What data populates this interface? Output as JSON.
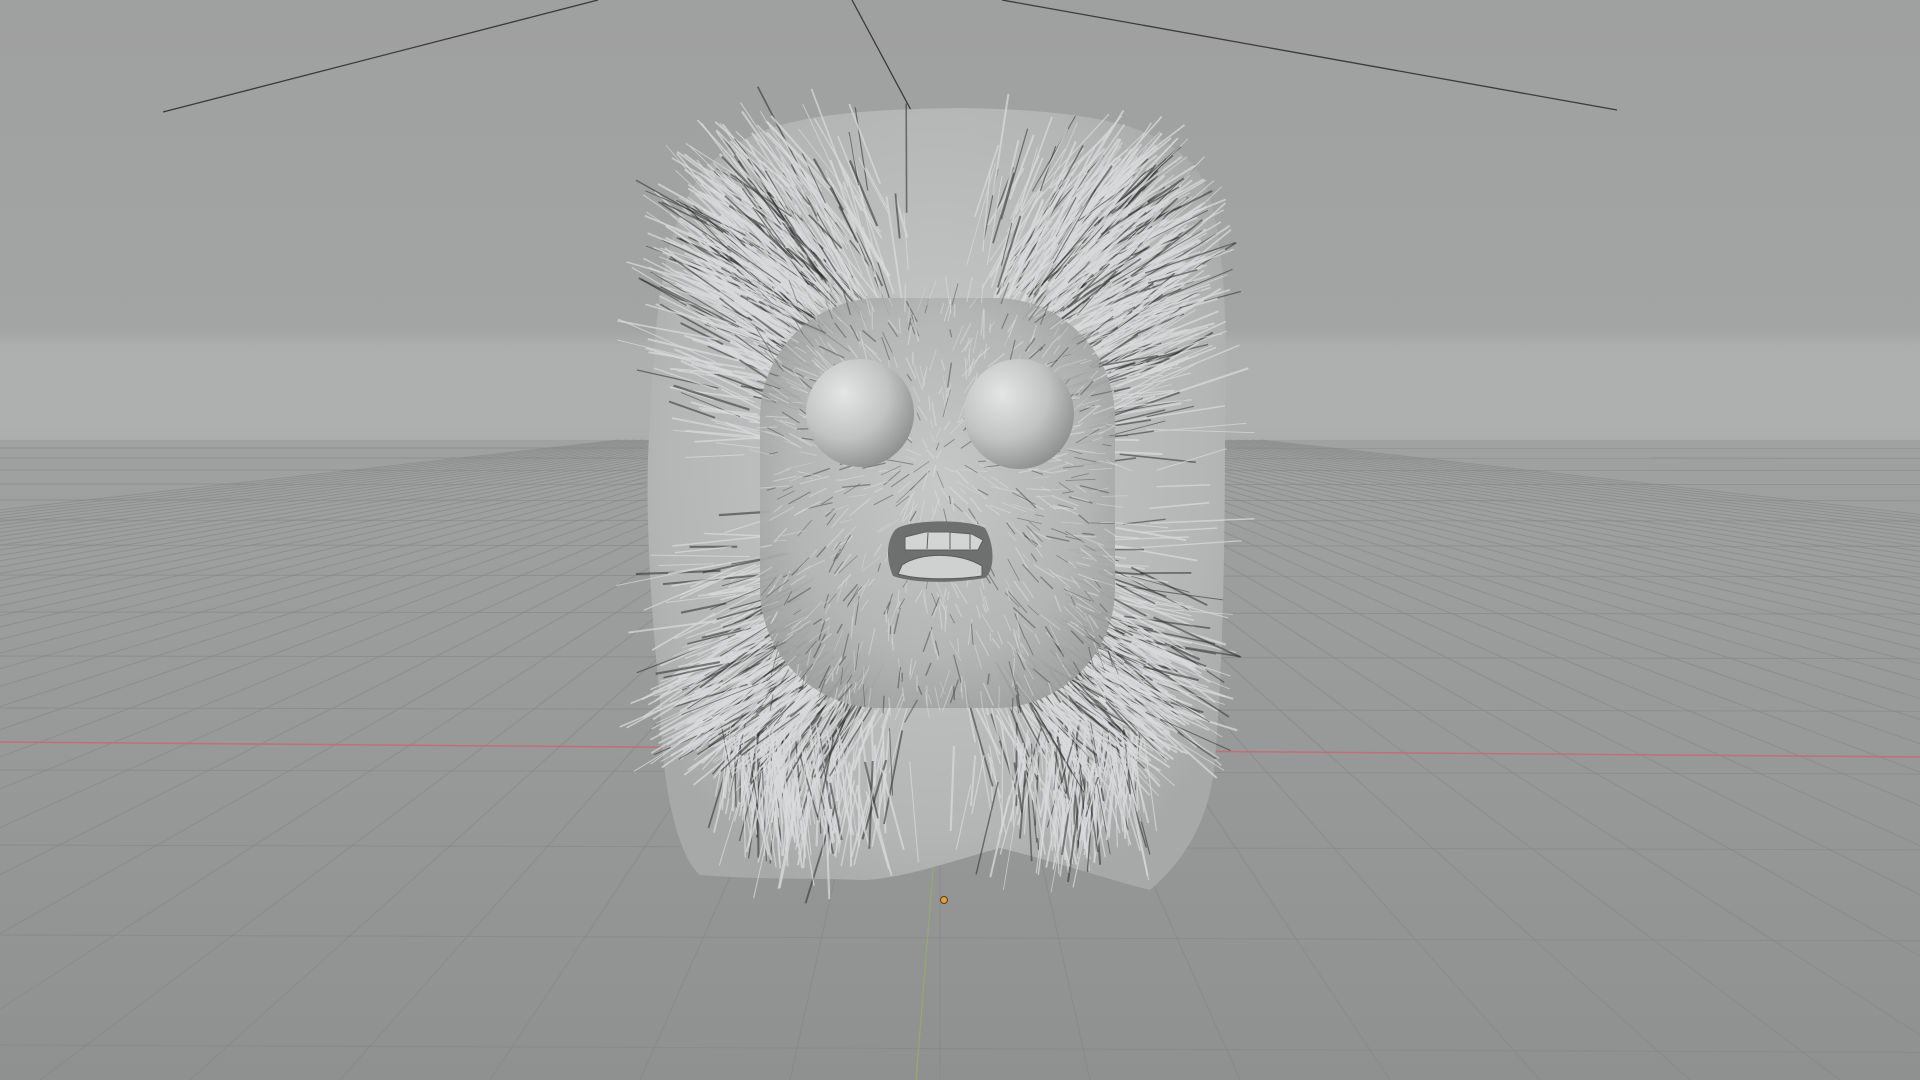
{
  "app": {
    "name": "3D viewport",
    "view": "perspective",
    "shading": "solid"
  },
  "colors": {
    "background_top": "#9fa0a0",
    "horizon_band": "#b0b1b1",
    "floor": "#989999",
    "grid_line": "#838484",
    "x_axis": "#c0707a",
    "y_axis": "#97a86a",
    "fur_light": "#d9dadb",
    "fur_dark": "#2c2c2c",
    "body_shade": "#b9baba",
    "eye": "#c9caca",
    "origin_marker": "#e0a040"
  },
  "scene_objects": [
    {
      "name": "fur-creature",
      "type": "mesh-with-hair-particles",
      "selected": false
    },
    {
      "name": "left-eye",
      "type": "sphere"
    },
    {
      "name": "right-eye",
      "type": "sphere"
    },
    {
      "name": "mouth",
      "type": "cavity-with-teeth"
    },
    {
      "name": "camera-or-light-wires",
      "type": "wire-lines"
    }
  ],
  "icons": [
    "object-origin-icon"
  ]
}
